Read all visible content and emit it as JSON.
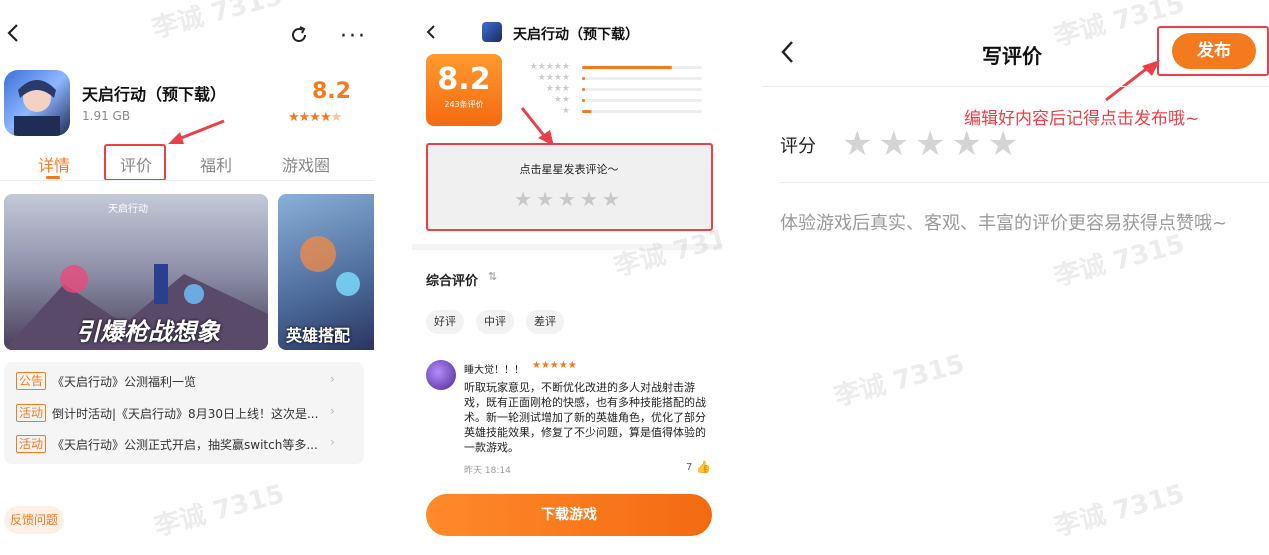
{
  "panel1": {
    "app_name": "天启行动（预下载）",
    "size": "1.91 GB",
    "score": "8.2",
    "tabs": [
      "详情",
      "评价",
      "福利",
      "游戏圈"
    ],
    "banner1_text": "引爆枪战想象",
    "banner1_logo": "天启行动",
    "banner2_text": "英雄搭配",
    "notices": [
      {
        "tag": "公告",
        "text": "《天启行动》公测福利一览"
      },
      {
        "tag": "活动",
        "text": "倒计时活动|《天启行动》8月30日上线！这次是..."
      },
      {
        "tag": "活动",
        "text": "《天启行动》公测正式开启，抽奖赢switch等多..."
      }
    ],
    "feedback": "反馈问题",
    "colors": {
      "accent": "#f47a20",
      "annotation": "#e8414a"
    }
  },
  "panel2": {
    "title": "天启行动（预下载）",
    "score": "8.2",
    "review_count": "243条评价",
    "bars": [
      0.75,
      0.02,
      0.02,
      0.02,
      0.08
    ],
    "prompt": "点击星星发表评论～",
    "overall_label": "综合评价",
    "filter_chips": [
      "好评",
      "中评",
      "差评"
    ],
    "review": {
      "user": "睡大觉！！！",
      "stars": 5,
      "text": "听取玩家意见，不断优化改进的多人对战射击游戏，既有正面刚枪的快感，也有多种技能搭配的战术。新一轮测试增加了新的英雄角色，优化了部分英雄技能效果，修复了不少问题，算是值得体验的一款游戏。",
      "time": "昨天 18:14",
      "likes": "7"
    },
    "download_button": "下载游戏"
  },
  "panel3": {
    "title": "写评价",
    "publish_button": "发布",
    "annotation": "编辑好内容后记得点击发布哦~",
    "rating_label": "评分",
    "placeholder": "体验游戏后真实、客观、丰富的评价更容易获得点赞哦~"
  },
  "watermark": "李诚 7315"
}
